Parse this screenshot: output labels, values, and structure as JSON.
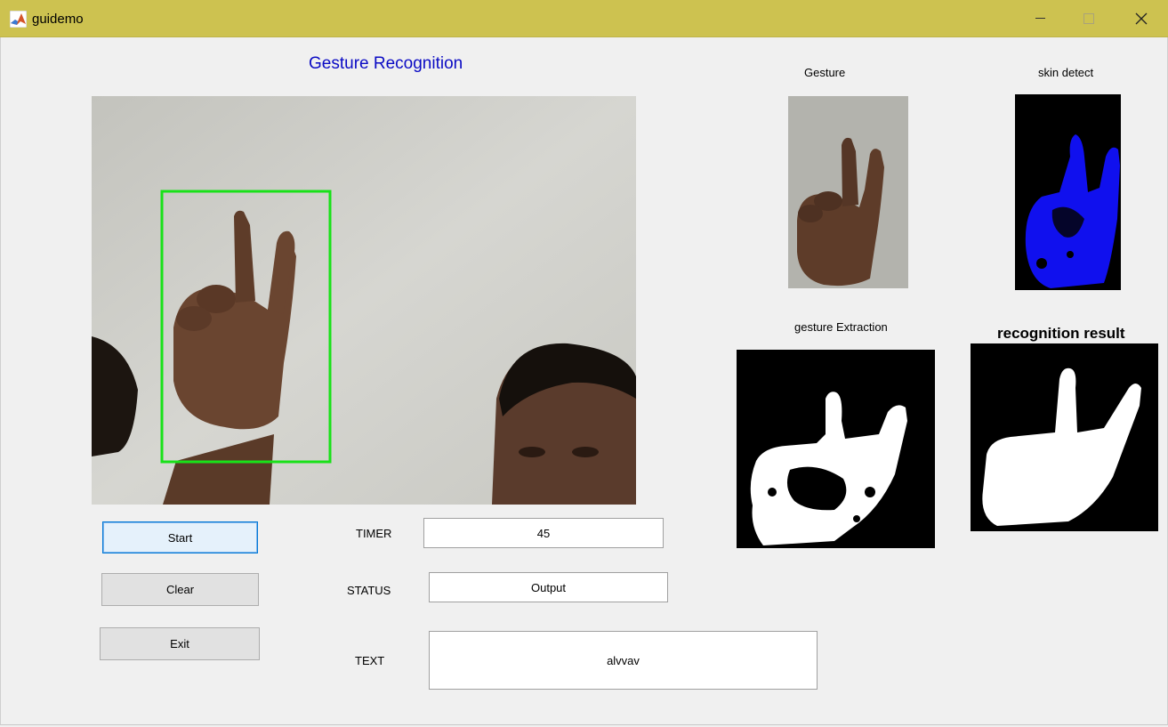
{
  "window": {
    "title": "guidemo"
  },
  "figure": {
    "heading": "Gesture Recognition",
    "axes": {
      "gesture_label": "Gesture",
      "skin_label": "skin detect",
      "extraction_label": "gesture Extraction",
      "result_label": "recognition result"
    }
  },
  "buttons": {
    "start": "Start",
    "clear": "Clear",
    "exit": "Exit"
  },
  "fields": {
    "timer_label": "TIMER",
    "timer_value": "45",
    "status_label": "STATUS",
    "status_value": "Output",
    "text_label": "TEXT",
    "text_value": "alvvav"
  },
  "colors": {
    "titlebar": "#cdc250",
    "heading": "#0b0bc4",
    "bbox": "#19e119",
    "skin": "#1010ee"
  }
}
